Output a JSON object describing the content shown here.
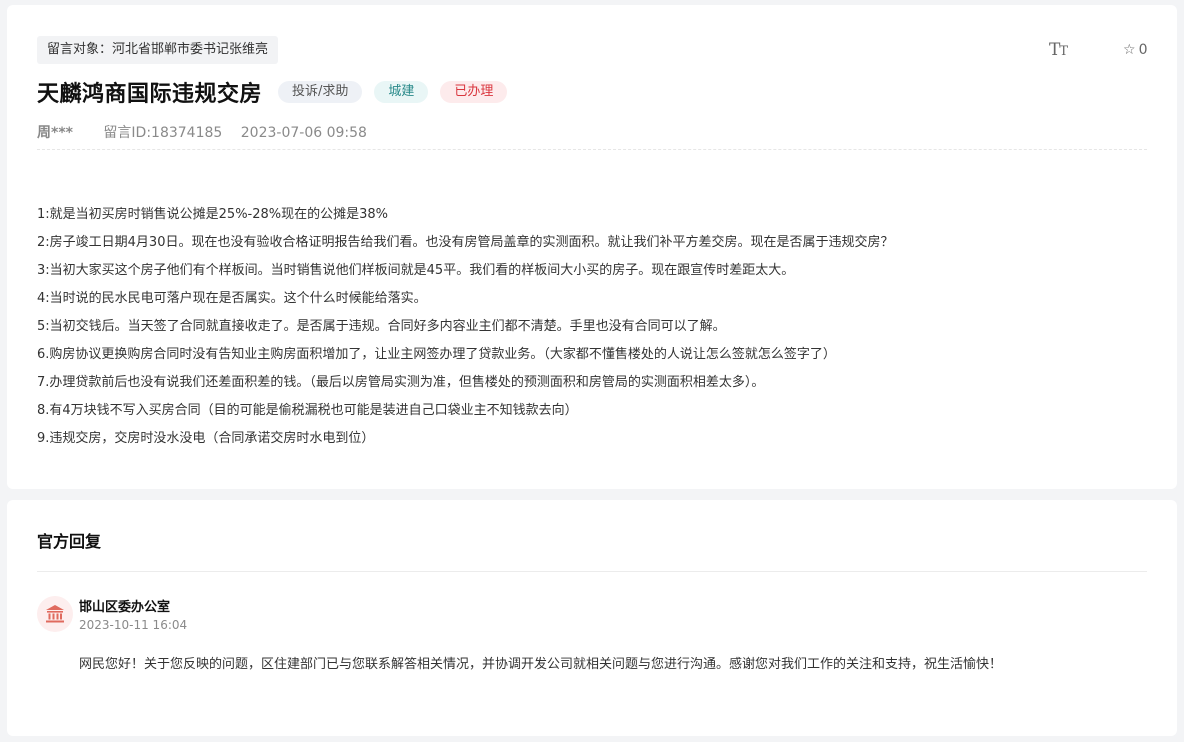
{
  "message": {
    "target": "留言对象：河北省邯郸市委书记张维亮",
    "title": "天麟鸿商国际违规交房",
    "tags": {
      "type": "投诉/求助",
      "category": "城建",
      "status": "已办理"
    },
    "author": "周***",
    "message_id": "留言ID:18374185",
    "datetime": "2023-07-06 09:58",
    "font_size_icon_label": "TT",
    "favorite_count": "0",
    "lines": [
      "1:就是当初买房时销售说公摊是25%-28%现在的公摊是38%",
      "2:房子竣工日期4月30日。现在也没有验收合格证明报告给我们看。也没有房管局盖章的实测面积。就让我们补平方差交房。现在是否属于违规交房？",
      "3:当初大家买这个房子他们有个样板间。当时销售说他们样板间就是45平。我们看的样板间大小买的房子。现在跟宣传时差距太大。",
      "4:当时说的民水民电可落户现在是否属实。这个什么时候能给落实。",
      "5:当初交钱后。当天签了合同就直接收走了。是否属于违规。合同好多内容业主们都不清楚。手里也没有合同可以了解。",
      "6.购房协议更换购房合同时没有告知业主购房面积增加了，让业主网签办理了贷款业务。（大家都不懂售楼处的人说让怎么签就怎么签字了）",
      "7.办理贷款前后也没有说我们还差面积差的钱。（最后以房管局实测为准，但售楼处的预测面积和房管局的实测面积相差太多）。",
      "8.有4万块钱不写入买房合同（目的可能是偷税漏税也可能是装进自己口袋业主不知钱款去向）",
      "9.违规交房，交房时没水没电（合同承诺交房时水电到位）"
    ]
  },
  "reply": {
    "heading": "官方回复",
    "department": "邯山区委办公室",
    "datetime": "2023-10-11 16:04",
    "text": "网民您好！关于您反映的问题，区住建部门已与您联系解答相关情况，并协调开发公司就相关问题与您进行沟通。感谢您对我们工作的关注和支持，祝生活愉快！",
    "avatar_icon": "government-building-icon",
    "accent_color": "#e06a5e"
  },
  "colors": {
    "status_red": "#d9363e",
    "category_teal": "#2a8a8a",
    "page_bg": "#f3f4f6"
  }
}
